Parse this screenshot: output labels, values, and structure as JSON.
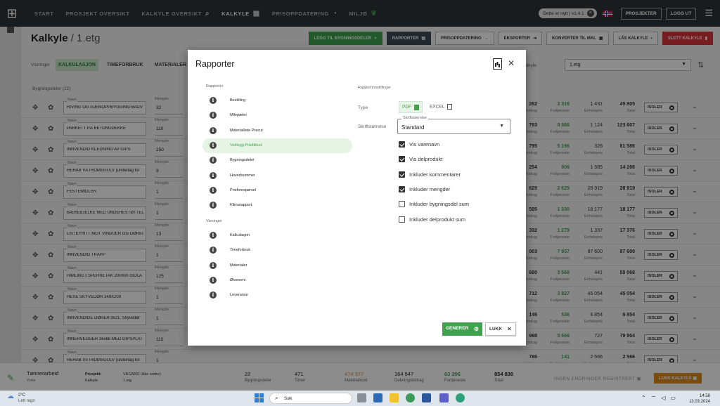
{
  "nav": {
    "items": [
      {
        "label": "START",
        "icon": ""
      },
      {
        "label": "PROSJEKT OVERSIKT",
        "icon": ""
      },
      {
        "label": "KALKYLE OVERSIKT",
        "icon": "search-icon"
      },
      {
        "label": "KALKYLE",
        "icon": "calculator-icon"
      },
      {
        "label": "PRISOPPDATERING",
        "icon": "history-icon"
      },
      {
        "label": "MILJØ",
        "icon": "leaf-icon"
      }
    ],
    "version": "Dette er nytt | v1.4.1",
    "projects_label": "PROSJEKTER",
    "logout_label": "LOGG UT"
  },
  "page": {
    "title": "Kalkyle",
    "subtitle": "/ 1.etg",
    "actions": [
      {
        "label": "LEGG TIL BYGNINGSDELER",
        "style": "green",
        "icon": "+"
      },
      {
        "label": "RAPPORTER",
        "style": "dark",
        "icon": "▤"
      },
      {
        "label": "PRISOPPDATERING",
        "style": "",
        "icon": "→"
      },
      {
        "label": "EKSPORTER",
        "style": "",
        "icon": "⇥"
      },
      {
        "label": "KONVERTER TIL MAL",
        "style": "",
        "icon": "▣"
      },
      {
        "label": "LÅS KALKYLE",
        "style": "",
        "icon": "🔒"
      },
      {
        "label": "SLETT KALKYLE",
        "style": "red",
        "icon": "🗑"
      }
    ],
    "views_label": "Visninger",
    "tabs": [
      "KALKULASJON",
      "TIMEFORBRUK",
      "MATERIALER"
    ],
    "level_label": "kalkyle",
    "level_value": "1.etg",
    "bygg_count": "Bygningsdeler (22)"
  },
  "rows": [
    {
      "name": "RIVING OG GJENOPPBYGGING BADV",
      "qty": "32",
      "c1": "262",
      "c2": "3 318",
      "c3": "1 431",
      "c4": "45 805"
    },
    {
      "name": "PARKETT PÅ BETONGDEKKE",
      "qty": "110",
      "c1": "793",
      "c2": "8 986",
      "c3": "1 124",
      "c4": "123 607"
    },
    {
      "name": "INNVENDIG KLEDNING AV GIPS",
      "qty": "250",
      "c1": "795",
      "c2": "5 196",
      "c3": "326",
      "c4": "81 586"
    },
    {
      "name": "REHAB VÅTROMSGULV (underlag for",
      "qty": "9",
      "c1": "254",
      "c2": "806",
      "c3": "1 585",
      "c4": "14 266"
    },
    {
      "name": "FESTEMIDLER",
      "qty": "1",
      "c1": "629",
      "c2": "2 629",
      "c3": "28 919",
      "c4": "28 919"
    },
    {
      "name": "BÆREBJELKE MED UNDERESTØTTEL",
      "qty": "1",
      "c1": "595",
      "c2": "1 330",
      "c3": "18 177",
      "c4": "18 177"
    },
    {
      "name": "LISTEFRITT MOT VINDUER OG DØREI",
      "qty": "13",
      "c1": "392",
      "c2": "1 279",
      "c3": "1 337",
      "c4": "17 376"
    },
    {
      "name": "INNVENDIG TRAPP",
      "qty": "1",
      "c1": "003",
      "c2": "7 957",
      "c3": "87 600",
      "c4": "87 600"
    },
    {
      "name": "HIMLING I SPERRETAK 200mm ISOLA",
      "qty": "125",
      "c1": "680",
      "c2": "3 566",
      "c3": "441",
      "c4": "55 068"
    },
    {
      "name": "HEVE SKYVEDØR 349X209",
      "qty": "1",
      "c1": "712",
      "c2": "3 827",
      "c3": "45 054",
      "c4": "45 054"
    },
    {
      "name": "INNVENDIGE DØRER 9x21, Skyvedør",
      "qty": "1",
      "c1": "146",
      "c2": "536",
      "c3": "6 854",
      "c4": "6 854"
    },
    {
      "name": "INNERVEGGER 36x68 MED GIPSPLAT",
      "qty": "110",
      "c1": "988",
      "c2": "5 656",
      "c3": "727",
      "c4": "79 964"
    },
    {
      "name": "REHAB VÅTROMSGULV (underlag for",
      "qty": "1",
      "c1": "786",
      "c2": "141",
      "c3": "2 566",
      "c4": "2 566"
    }
  ],
  "row_labels": {
    "name_label": "Navn",
    "qty_label": "Mengde",
    "c1_sub": "bidrag",
    "c2_sub": "Fortjeneste",
    "c3_sub": "Enhetspris",
    "c4_sub": "Total",
    "isolate": "ISOLER"
  },
  "bottom": {
    "title": "Tømrerarbeid",
    "subtitle": "Ynke",
    "project_label": "Prosjekt:",
    "project_value": "VEGARD (ikke endre)",
    "calc_label": "Kalkyle:",
    "calc_value": "1.etg",
    "stats": [
      {
        "value": "22",
        "label": "Bygningsdeler",
        "cls": ""
      },
      {
        "value": "471",
        "label": "Timer",
        "cls": ""
      },
      {
        "value": "474 377",
        "label": "Materialkost",
        "cls": "orange"
      },
      {
        "value": "164 547",
        "label": "Dekningsbidrag",
        "cls": ""
      },
      {
        "value": "63 296",
        "label": "Fortjeneste",
        "cls": "green"
      },
      {
        "value": "854 830",
        "label": "Total",
        "cls": "bold"
      }
    ],
    "no_changes": "INGEN ENDRINGER REGISTRERT",
    "close_calc": "LUKK KALKYLE"
  },
  "modal": {
    "title": "Rapporter",
    "reports_section": "Rapporter",
    "reports": [
      "Bestilling",
      "Milepæler",
      "Materialliste Precut",
      "Vedlegg Prisltilbud",
      "Bygningsdeler",
      "Hovedsummer",
      "Prisforespørsel",
      "Klimarapport"
    ],
    "selected_report": "Vedlegg Prisltilbud",
    "views_section": "Visninger",
    "views": [
      "Kalkulasjon",
      "Timeforbruk",
      "Materialer",
      "Økonomi",
      "Leveranse"
    ],
    "settings_label": "Rapportinnstillinger",
    "type_label": "Type",
    "type_pdf": "PDF",
    "type_excel": "EXCEL",
    "font_size_label": "Skriftstørrelse",
    "font_size_field_label": "Skriftstørrelse",
    "font_size_value": "Standard",
    "checkboxes": [
      {
        "label": "Vis varenavn",
        "checked": true
      },
      {
        "label": "Vis delprodukt",
        "checked": true
      },
      {
        "label": "Inkluder kommentarer",
        "checked": true
      },
      {
        "label": "Inkluder mengder",
        "checked": true
      },
      {
        "label": "Inkluder bygningsdel sum",
        "checked": false
      },
      {
        "label": "Inkluder delprodukt sum",
        "checked": false
      }
    ],
    "generate_label": "GENERER",
    "close_label": "LUKK"
  },
  "taskbar": {
    "temp": "2°C",
    "weather": "Lett regn",
    "search": "Søk",
    "time": "14:58",
    "date": "13.03.2024"
  }
}
